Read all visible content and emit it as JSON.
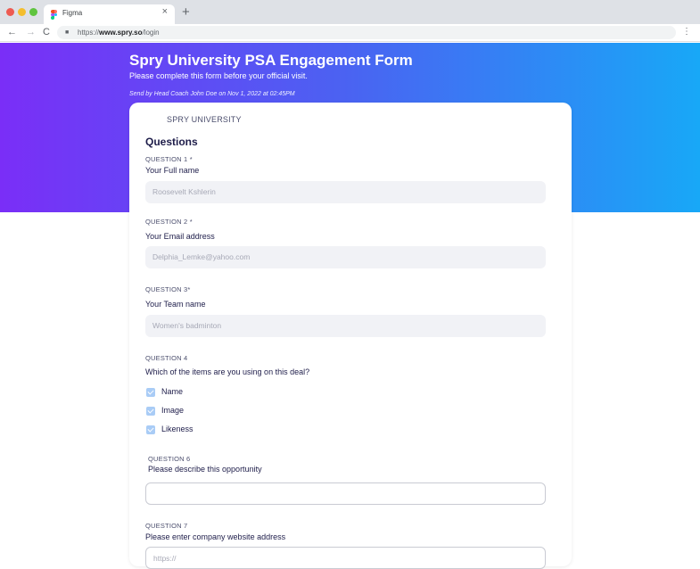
{
  "browser": {
    "tab_title": "Figma",
    "tab_close": "×",
    "new_tab": "+",
    "nav_back": "←",
    "nav_forward": "→",
    "nav_reload": "C",
    "url_prefix": "https://",
    "url_host": "www.spry.so",
    "url_path": "/login",
    "menu": "⋮"
  },
  "hero": {
    "title": "Spry University PSA Engagement Form",
    "subtitle": "Please complete this form before your official visit.",
    "meta": "Send by Head Coach John Doe on Nov 1, 2022 at 02:45PM"
  },
  "form": {
    "brand": "SPRY UNIVERSITY",
    "section_title": "Questions",
    "q1": {
      "number": "QUESTION 1 *",
      "text": "Your Full name",
      "value": "Roosevelt Kshlerin"
    },
    "q2": {
      "number": "QUESTION 2 *",
      "text": "Your Email address",
      "value": "Delphia_Lemke@yahoo.com"
    },
    "q3": {
      "number": "QUESTION 3*",
      "text": "Your Team name",
      "value": "Women's badminton"
    },
    "q4": {
      "number": "QUESTION 4",
      "text": "Which of the items are you using on this deal?",
      "options": [
        "Name",
        "Image",
        "Likeness"
      ]
    },
    "q6": {
      "number": "QUESTION 6",
      "text": "Please describe this opportunity",
      "value": ""
    },
    "q7": {
      "number": "QUESTION 7",
      "text": "Please enter company website address",
      "placeholder": "https://"
    }
  },
  "colors": {
    "gradient_start": "#7a2ef7",
    "gradient_end": "#18a8f7",
    "checkbox": "#a9ccf6",
    "heading": "#1e1d4a"
  }
}
